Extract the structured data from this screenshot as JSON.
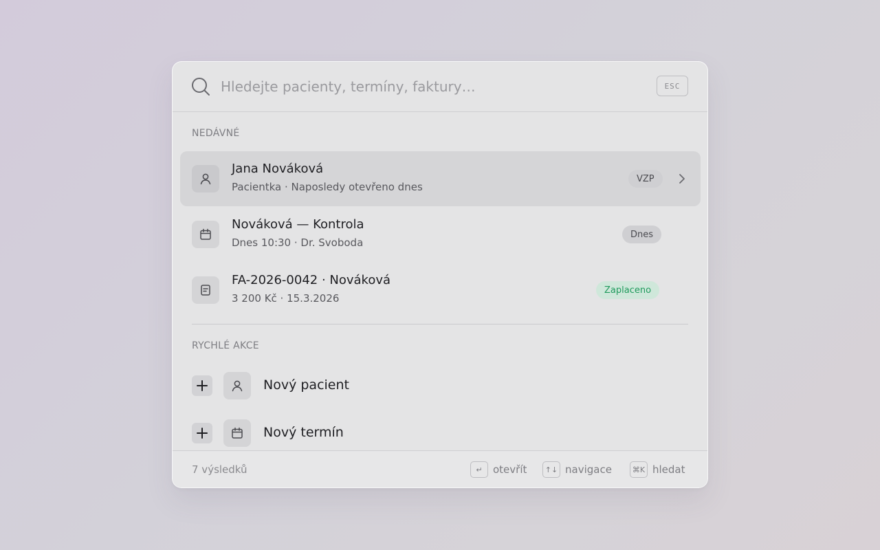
{
  "search": {
    "placeholder": "Hledejte pacienty, termíny, faktury…",
    "esc_label": "ESC",
    "icon": "search-icon"
  },
  "recent": {
    "heading": "NEDÁVNÉ",
    "items": [
      {
        "icon": "person-icon",
        "title": "Jana Nováková",
        "subtitle": "Pacientka · Naposledy otevřeno dnes",
        "badge": "VZP",
        "badge_color": "#cfcfd2",
        "active": true,
        "chevron": "chevron-right-icon"
      },
      {
        "icon": "calendar-icon",
        "title": "Nováková — Kontrola",
        "subtitle": "Dnes 10:30 · Dr. Svoboda",
        "badge": "Dnes",
        "badge_color": "#cfcfd2",
        "active": false
      },
      {
        "icon": "invoice-icon",
        "title": "FA-2026-0042 · Nováková",
        "subtitle": "3 200 Kč · 15.3.2026",
        "badge": "Zaplaceno",
        "badge_color": "#1f9a5c",
        "active": false
      }
    ]
  },
  "quick_actions": {
    "heading": "RYCHLÉ AKCE",
    "items": [
      {
        "icon": "person-icon",
        "label": "Nový pacient"
      },
      {
        "icon": "calendar-icon",
        "label": "Nový termín"
      }
    ]
  },
  "footer": {
    "result_count": "7 výsledků",
    "hints": [
      {
        "key": "↵",
        "label": "otevřít"
      },
      {
        "key": "↑↓",
        "label": "navigace"
      },
      {
        "key": "⌘K",
        "label": "hledat"
      }
    ]
  },
  "colors": {
    "accent_green": "#1f9a5c",
    "active_row": "#d5d5d7",
    "panel": "#e4e4e5"
  }
}
